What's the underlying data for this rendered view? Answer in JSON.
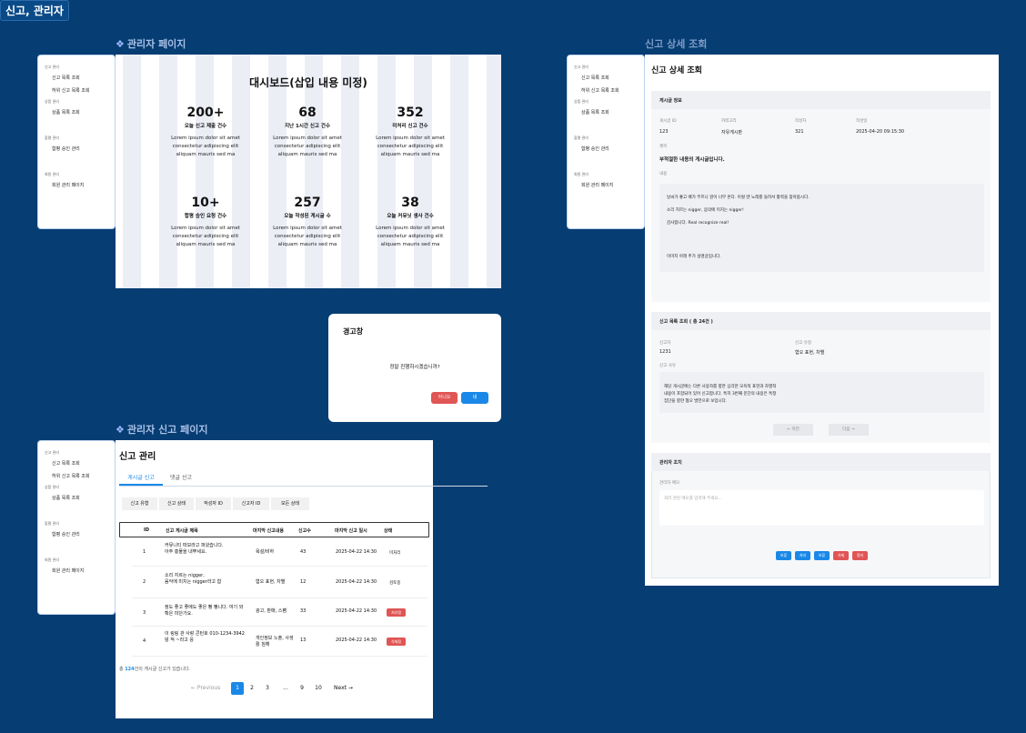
{
  "canvas": {
    "title": "신고, 관리자"
  },
  "labels": {
    "admin_page": "관리자 페이지",
    "report_page": "관리자 신고 페이지",
    "detail_page": "신고 상세 조회",
    "diamond": "❖"
  },
  "sidebar": {
    "s1": "신고 관리",
    "i1": "신고 목록 조회",
    "i2": "허위 신고 목록 조회",
    "s2": "상품 관리",
    "i3": "상품 목록 조회",
    "s3": "합평 관리",
    "i4": "합평 승인 관리",
    "s4": "회원 관리",
    "i5": "회원 관리 페이지"
  },
  "dashboard": {
    "title": "대시보드(삽입 내용 미정)",
    "desc": [
      "Lorem ipsum dolor sit amet",
      "consectetur adipiscing elit",
      "aliquam mauris sed ma"
    ],
    "stats": [
      {
        "num": "200+",
        "label": "오늘 신고 제출 건수"
      },
      {
        "num": "68",
        "label": "지난 1시간 신고 건수"
      },
      {
        "num": "352",
        "label": "미처리 신고 건수"
      },
      {
        "num": "10+",
        "label": "합평 승인 요청 건수"
      },
      {
        "num": "257",
        "label": "오늘 작성된 게시글 수"
      },
      {
        "num": "38",
        "label": "오늘 커뮤닛 생사 건수"
      }
    ]
  },
  "modal": {
    "title": "경고창",
    "message": "정말 진행하시겠습니까?",
    "cancel": "아니오",
    "confirm": "네"
  },
  "report_list": {
    "title": "신고 관리",
    "tabs": [
      "게시글 신고",
      "댓글 신고"
    ],
    "filters": [
      "신고 유형",
      "신고 상태",
      "작성자 ID",
      "신고자 ID",
      "모든 상태"
    ],
    "headers": [
      "ID",
      "신고 게시글 제목",
      "마지막 신고내용",
      "신고수",
      "마지막 신고 일시",
      "상태"
    ],
    "rows": [
      {
        "id": "1",
        "title1": "커뮤니티 떠보라고 퍼왔습니다.",
        "title2": "아주 흥물을 내뿌세요.",
        "content": "욕설/비하",
        "count": "43",
        "date": "2025-04-22 14:30",
        "status": "미처리"
      },
      {
        "id": "2",
        "title1": "소리 지르는 nigger,",
        "title2": "음악에 미치는 nigger라고 함",
        "content": "혐오 표현, 차별",
        "count": "12",
        "date": "2025-04-22 14:30",
        "status": "검토중"
      },
      {
        "id": "3",
        "title1": "정도 좋고 좋에도 좋은 뻥 뻥니다. 여기 와",
        "title2": "확은 미단가요.",
        "content": "광고, 판매, 스팸",
        "count": "33",
        "date": "2025-04-22 14:30",
        "status": "처리됨"
      },
      {
        "id": "4",
        "title1": "이 링링 관 사랑 콘턴호 010-1234-3942",
        "title2": "덩 적 ~라고 응",
        "content": "개인정보 노출, 사생활 침해",
        "count": "13",
        "date": "2025-04-22 14:30",
        "status": "삭제됨"
      }
    ],
    "total_prefix": "총 ",
    "total_count": "124",
    "total_suffix": "건의 게시글 신고가 있습니다.",
    "pagination": {
      "prev": "← Previous",
      "pages": [
        "1",
        "2",
        "3",
        "...",
        "9",
        "10"
      ],
      "next": "Next →"
    }
  },
  "detail": {
    "title": "신고 상세 조회",
    "post_info": "게시글 정보",
    "post_fields": [
      {
        "label": "게시글 ID",
        "value": "123"
      },
      {
        "label": "카테고리",
        "value": "자유게시판"
      },
      {
        "label": "작성자",
        "value": "321"
      },
      {
        "label": "작성일",
        "value": "2025-04-20 09:15:30"
      }
    ],
    "subject_label": "제목",
    "subject": "부적절한 내용의 게시글입니다.",
    "content_label": "내용",
    "content_lines": [
      "날씨가 좋고 배가 부르니 뭔이 너무 온다. 이럴 땐 노래를 들려서 활력을 찾아봅시다.",
      "소리 지르는 nigger, 음악에 미치는 nigger!",
      "감사합니다. Real recognize real!",
      "",
      "",
      "이미지 아래 추가 설명글입니다."
    ],
    "report_list_title": "신고 목록 조회 ( 총 24건 )",
    "reporter_label": "신고자",
    "reporter": "1231",
    "type_label": "신고 유형",
    "type": "혐오 표현, 차별",
    "reason_label": "신고 사유",
    "reason_lines": [
      "해당 게시글에는 다른 사용자를 향한 심각한 모욕적 표현과 차별적",
      "내용이 포함되어 있어 신고합니다. 특히 3번째 문단의 내용은 특정",
      "집단을 향한 혐오 발언으로 보입니다."
    ],
    "prev": "←  이전",
    "next": "다음  →",
    "action_title": "관리자 조치",
    "memo_label": "관리자 메모",
    "memo_placeholder": "처리 관련 메모를 입력해 주세요...",
    "buttons": [
      "보류",
      "처리",
      "보류",
      "삭제",
      "정지"
    ]
  },
  "colors": {
    "blue": "#1a88e8",
    "red": "#e05555",
    "navy": "#063d73"
  }
}
